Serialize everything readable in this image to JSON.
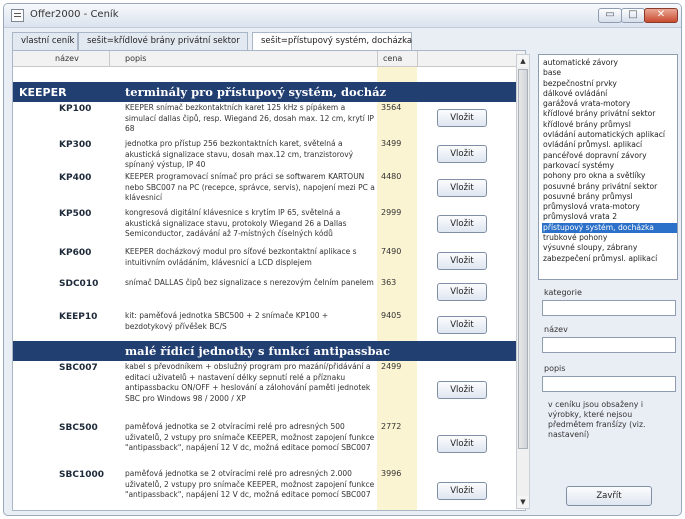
{
  "window": {
    "title": "Offer2000 - Ceník",
    "controls": {
      "minimize": "▭",
      "maximize": "□",
      "close": "✕"
    }
  },
  "tabs": [
    {
      "label": "vlastní ceník"
    },
    {
      "label": "sešit=křídlové brány privátní sektor"
    },
    {
      "label": "sešit=přístupový systém, docházka",
      "active": true
    }
  ],
  "table": {
    "columns": [
      "název",
      "popis",
      "cena"
    ],
    "sections": [
      {
        "label": "KEEPER",
        "title": "terminály pro přístupový systém, docház"
      },
      {
        "label": "",
        "title": "malé řídicí jednotky s funkcí antipassbac"
      }
    ],
    "rows": [
      {
        "code": "KP100",
        "desc": "KEEPER snímač bezkontaktních karet 125 kHz s pípákem a simulací dallas čipů, resp. Wiegand 26, dosah max. 12 cm, krytí IP 68",
        "price": "3564"
      },
      {
        "code": "KP300",
        "desc": "jednotka pro přístup 256 bezkontaktních karet, světelná a akustická signalizace stavu, dosah max.12 cm, tranzistorový spínaný výstup, IP 40",
        "price": "3499"
      },
      {
        "code": "KP400",
        "desc": "KEEPER programovací snímač pro práci se softwarem KARTOUN nebo SBC007 na PC (recepce, správce, servis), napojení mezi PC a klávesnicí",
        "price": "4480"
      },
      {
        "code": "KP500",
        "desc": "kongresová digitální klávesnice s krytím IP 65, světelná a akustická signalizace stavu, protokoly Wiegand 26 a Dallas Semiconductor, zadávání až 7-místných číselných kódů",
        "price": "2999"
      },
      {
        "code": "KP600",
        "desc": "KEEPER docházkový modul pro síťové bezkontaktní aplikace s intuitivním ovládáním, klávesnicí a LCD displejem",
        "price": "7490"
      },
      {
        "code": "SDC010",
        "desc": "snímač DALLAS čipů bez signalizace s nerezovým čelním panelem",
        "price": "363"
      },
      {
        "code": "KEEP10",
        "desc": "kit: paměťová jednotka SBC500 + 2 snímače KP100 + bezdotykový přívěšek BC/S",
        "price": "9405"
      },
      {
        "code": "SBC007",
        "desc": "kabel s převodníkem + obslužný program pro mazání/přidávání a editaci uživatelů + nastavení délky sepnutí relé a příznaku antipassbacku ON/OFF + heslování a zálohování paměti jednotek SBC pro Windows 98 / 2000 / XP",
        "price": "2499"
      },
      {
        "code": "SBC500",
        "desc": "paměťová jednotka se 2 otvíracími relé pro adresných 500 uživatelů, 2 vstupy pro snímače KEEPER, možnost zapojení funkce \"antipassback\", napájení 12 V dc, možná editace pomocí SBC007",
        "price": "2772"
      },
      {
        "code": "SBC1000",
        "desc": "paměťová jednotka se 2 otvíracími relé pro adresných 2.000 uživatelů, 2 vstupy pro snímače KEEPER, možnost zapojení funkce \"antipassback\", napájení 12 V dc, možná editace pomocí SBC007",
        "price": "3996"
      }
    ],
    "insert_label": "Vložit"
  },
  "scrollbar": {
    "up": "▲",
    "down": "▼"
  },
  "categories": [
    "automatické závory",
    "base",
    "bezpečnostní prvky",
    "dálkové ovládání",
    "garážová vrata-motory",
    "křídlové brány privátní sektor",
    "křídlové brány průmysl",
    "ovládání automatických aplikací",
    "ovládání průmysl. aplikací",
    "pancéřové dopravní závory",
    "parkovací systémy",
    "pohony pro okna a světlíky",
    "posuvné brány privátní sektor",
    "posuvné brány průmysl",
    "průmyslová vrata-motory",
    "průmyslová vrata 2",
    "přístupový systém, docházka",
    "trubkové pohony",
    "výsuvné sloupy, zábrany",
    "zabezpečení průmysl. aplikací"
  ],
  "selected_category": "přístupový systém, docházka",
  "fields": {
    "kategorie_label": "kategorie",
    "nazev_label": "název",
    "popis_label": "popis",
    "kategorie_value": "",
    "nazev_value": "",
    "popis_value": ""
  },
  "note": "v ceníku jsou obsaženy i výrobky, které nejsou předmětem franšízy (viz. nastavení)",
  "close_label": "Zavřít"
}
